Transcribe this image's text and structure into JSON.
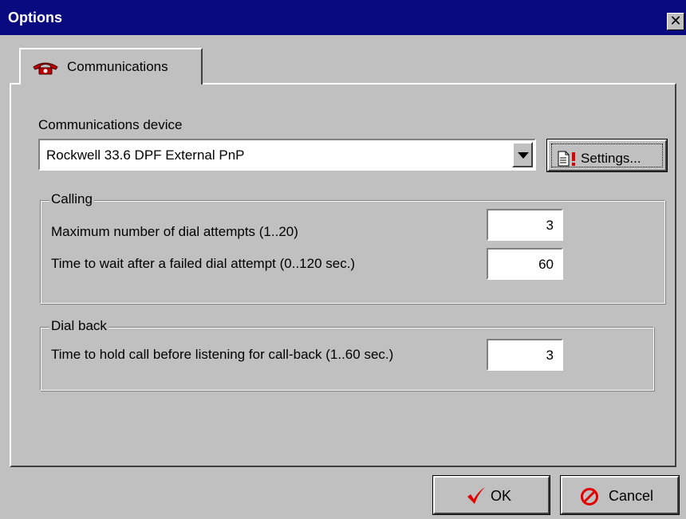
{
  "window": {
    "title": "Options",
    "close_glyph": "✕"
  },
  "tabs": [
    {
      "label": "Communications",
      "icon": "telephone-icon",
      "icon_color": "#c00000"
    }
  ],
  "device": {
    "label": "Communications device",
    "selected": "Rockwell 33.6 DPF External PnP",
    "settings_label": "Settings...",
    "settings_icon": "document-warning-icon"
  },
  "calling": {
    "title": "Calling",
    "max_attempts_label": "Maximum number of dial attempts (1..20)",
    "max_attempts_value": "3",
    "wait_label": "Time to wait after a failed dial attempt (0..120 sec.)",
    "wait_value": "60"
  },
  "dial_back": {
    "title": "Dial back",
    "hold_label": "Time to hold call before listening for call-back (1..60 sec.)",
    "hold_value": "3"
  },
  "buttons": {
    "ok_label": "OK",
    "ok_icon": "checkmark-icon",
    "ok_icon_color": "#e00000",
    "cancel_label": "Cancel",
    "cancel_icon": "no-entry-icon",
    "cancel_icon_color": "#e00000"
  }
}
